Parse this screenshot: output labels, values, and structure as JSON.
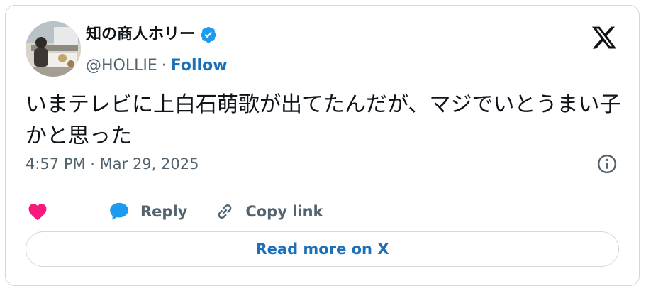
{
  "author": {
    "display_name": "知の商人ホリー",
    "handle": "@HOLLIE",
    "separator": "·",
    "follow_label": "Follow",
    "verified": true,
    "verified_icon": "verified-badge-icon"
  },
  "tweet": {
    "text": "いまテレビに上白石萌歌が出てたんだが、マジでいとうまい子かと思った",
    "timestamp": "4:57 PM · Mar 29, 2025"
  },
  "actions": {
    "like_icon": "heart-icon",
    "reply_label": "Reply",
    "copy_link_label": "Copy link"
  },
  "footer": {
    "read_more_label": "Read more on X"
  },
  "colors": {
    "accent": "#1d9bf0",
    "link": "#1d6fb8",
    "heart": "#f91880",
    "muted": "#536471",
    "border": "#cfd9de"
  }
}
